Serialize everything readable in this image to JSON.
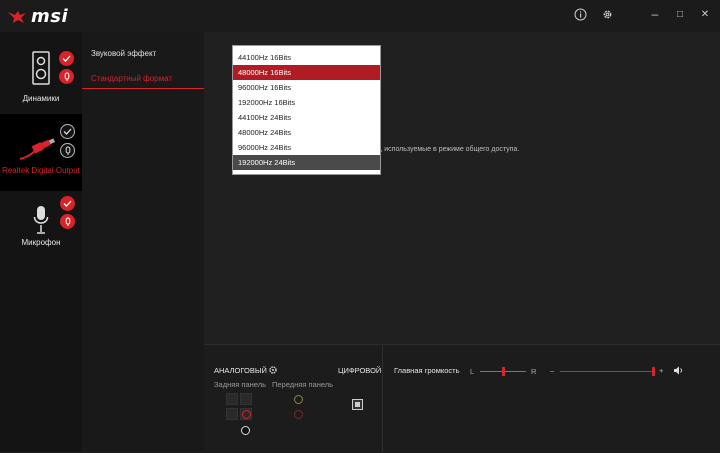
{
  "app": {
    "logo_text": "msi"
  },
  "titlebar": {
    "info_icon": "info-icon",
    "settings_icon": "gear-icon",
    "minimize": "–",
    "maximize": "□",
    "close": "✕"
  },
  "devices": [
    {
      "label": "Динамики",
      "icon": "speaker-icon"
    },
    {
      "label": "Realtek Digital Output",
      "icon": "digital-cable-icon"
    },
    {
      "label": "Микрофон",
      "icon": "microphone-icon"
    }
  ],
  "menu": {
    "sound_effect": "Звуковой эффект",
    "default_format": "Стандартный формат"
  },
  "main": {
    "hint": "сть, используемые в режиме общего доступа."
  },
  "dropdown": {
    "options": [
      "44100Hz 16Bits",
      "48000Hz 16Bits",
      "96000Hz 16Bits",
      "192000Hz 16Bits",
      "44100Hz 24Bits",
      "48000Hz 24Bits",
      "96000Hz 24Bits",
      "192000Hz 24Bits"
    ],
    "selected": "48000Hz 16Bits",
    "hovered": "192000Hz 24Bits"
  },
  "connectors": {
    "analog": "АНАЛОГОВЫЙ",
    "digital": "ЦИФРОВОЙ",
    "rear": "Задняя панель",
    "front": "Передняя панель"
  },
  "volume": {
    "label": "Главная громкость",
    "left": "L",
    "right": "R",
    "minus": "–",
    "plus": "+",
    "level": 1.0,
    "balance": 0.5
  },
  "colors": {
    "accent": "#d8232a",
    "background": "#1f1f1f"
  }
}
